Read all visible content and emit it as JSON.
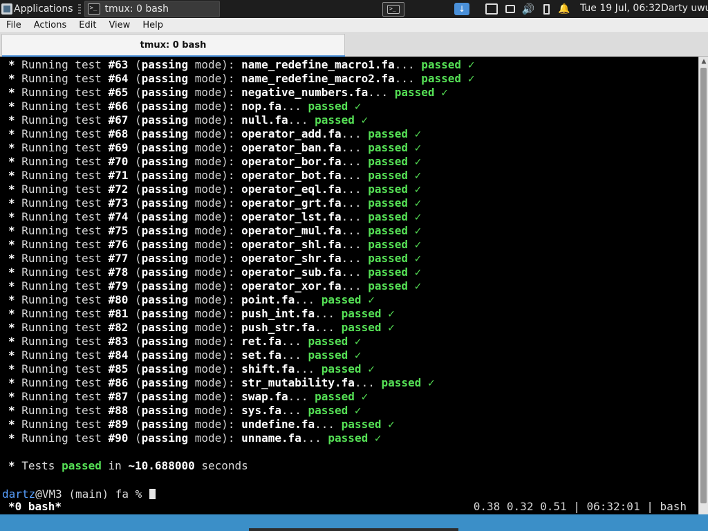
{
  "panel": {
    "applications_label": "Applications",
    "task_title": "tmux: 0 bash",
    "datetime": "Tue 19 Jul, 06:32",
    "user": "Darty uwu"
  },
  "menu": {
    "file": "File",
    "actions": "Actions",
    "edit": "Edit",
    "view": "View",
    "help": "Help"
  },
  "tab": {
    "title": "tmux: 0 bash"
  },
  "terminal": {
    "lines": [
      {
        "num": "#63",
        "file": "name_redefine_macro1.fa"
      },
      {
        "num": "#64",
        "file": "name_redefine_macro2.fa"
      },
      {
        "num": "#65",
        "file": "negative_numbers.fa"
      },
      {
        "num": "#66",
        "file": "nop.fa"
      },
      {
        "num": "#67",
        "file": "null.fa"
      },
      {
        "num": "#68",
        "file": "operator_add.fa"
      },
      {
        "num": "#69",
        "file": "operator_ban.fa"
      },
      {
        "num": "#70",
        "file": "operator_bor.fa"
      },
      {
        "num": "#71",
        "file": "operator_bot.fa"
      },
      {
        "num": "#72",
        "file": "operator_eql.fa"
      },
      {
        "num": "#73",
        "file": "operator_grt.fa"
      },
      {
        "num": "#74",
        "file": "operator_lst.fa"
      },
      {
        "num": "#75",
        "file": "operator_mul.fa"
      },
      {
        "num": "#76",
        "file": "operator_shl.fa"
      },
      {
        "num": "#77",
        "file": "operator_shr.fa"
      },
      {
        "num": "#78",
        "file": "operator_sub.fa"
      },
      {
        "num": "#79",
        "file": "operator_xor.fa"
      },
      {
        "num": "#80",
        "file": "point.fa"
      },
      {
        "num": "#81",
        "file": "push_int.fa"
      },
      {
        "num": "#82",
        "file": "push_str.fa"
      },
      {
        "num": "#83",
        "file": "ret.fa"
      },
      {
        "num": "#84",
        "file": "set.fa"
      },
      {
        "num": "#85",
        "file": "shift.fa"
      },
      {
        "num": "#86",
        "file": "str_mutability.fa"
      },
      {
        "num": "#87",
        "file": "swap.fa"
      },
      {
        "num": "#88",
        "file": "sys.fa"
      },
      {
        "num": "#89",
        "file": "undefine.fa"
      },
      {
        "num": "#90",
        "file": "unname.fa"
      }
    ],
    "running_label": "Running test",
    "mode_label": "passing",
    "mode_word": "mode",
    "passed_label": "passed",
    "summary": {
      "prefix": "Tests",
      "passed": "passed",
      "in": "in",
      "time": "~10.688000",
      "unit": "seconds"
    },
    "prompt": {
      "user": "dartz",
      "host": "@VM3 (main) fa % "
    }
  },
  "status": {
    "window": "*0 bash*",
    "right": "0.38 0.32 0.51 | 06:32:01 | bash"
  },
  "colors": {
    "terminal_bg": "#000000",
    "passed": "#55e055",
    "prompt_user": "#58a0ff",
    "accent": "#4a90d9"
  }
}
